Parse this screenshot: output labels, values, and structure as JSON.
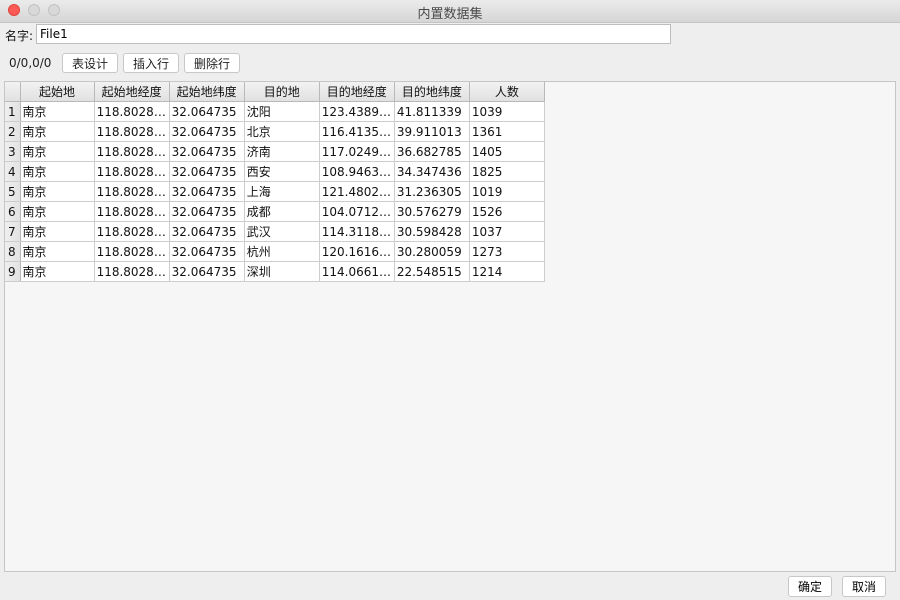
{
  "window": {
    "title": "内置数据集"
  },
  "form": {
    "name_label": "名字:",
    "name_value": "File1"
  },
  "toolbar": {
    "counter": "0/0,0/0",
    "design_label": "表设计",
    "insert_label": "插入行",
    "delete_label": "删除行"
  },
  "table": {
    "columns": [
      "起始地",
      "起始地经度",
      "起始地纬度",
      "目的地",
      "目的地经度",
      "目的地纬度",
      "人数"
    ],
    "rows": [
      [
        "1",
        "南京",
        "118.8028…",
        "32.064735",
        "沈阳",
        "123.4389…",
        "41.811339",
        "1039"
      ],
      [
        "2",
        "南京",
        "118.8028…",
        "32.064735",
        "北京",
        "116.4135…",
        "39.911013",
        "1361"
      ],
      [
        "3",
        "南京",
        "118.8028…",
        "32.064735",
        "济南",
        "117.0249…",
        "36.682785",
        "1405"
      ],
      [
        "4",
        "南京",
        "118.8028…",
        "32.064735",
        "西安",
        "108.9463…",
        "34.347436",
        "1825"
      ],
      [
        "5",
        "南京",
        "118.8028…",
        "32.064735",
        "上海",
        "121.4802…",
        "31.236305",
        "1019"
      ],
      [
        "6",
        "南京",
        "118.8028…",
        "32.064735",
        "成都",
        "104.0712…",
        "30.576279",
        "1526"
      ],
      [
        "7",
        "南京",
        "118.8028…",
        "32.064735",
        "武汉",
        "114.3118…",
        "30.598428",
        "1037"
      ],
      [
        "8",
        "南京",
        "118.8028…",
        "32.064735",
        "杭州",
        "120.1616…",
        "30.280059",
        "1273"
      ],
      [
        "9",
        "南京",
        "118.8028…",
        "32.064735",
        "深圳",
        "114.0661…",
        "22.548515",
        "1214"
      ]
    ]
  },
  "footer": {
    "ok_label": "确定",
    "cancel_label": "取消"
  },
  "colors": {
    "close": "#fc5b57",
    "window_bg": "#eeeeef"
  }
}
